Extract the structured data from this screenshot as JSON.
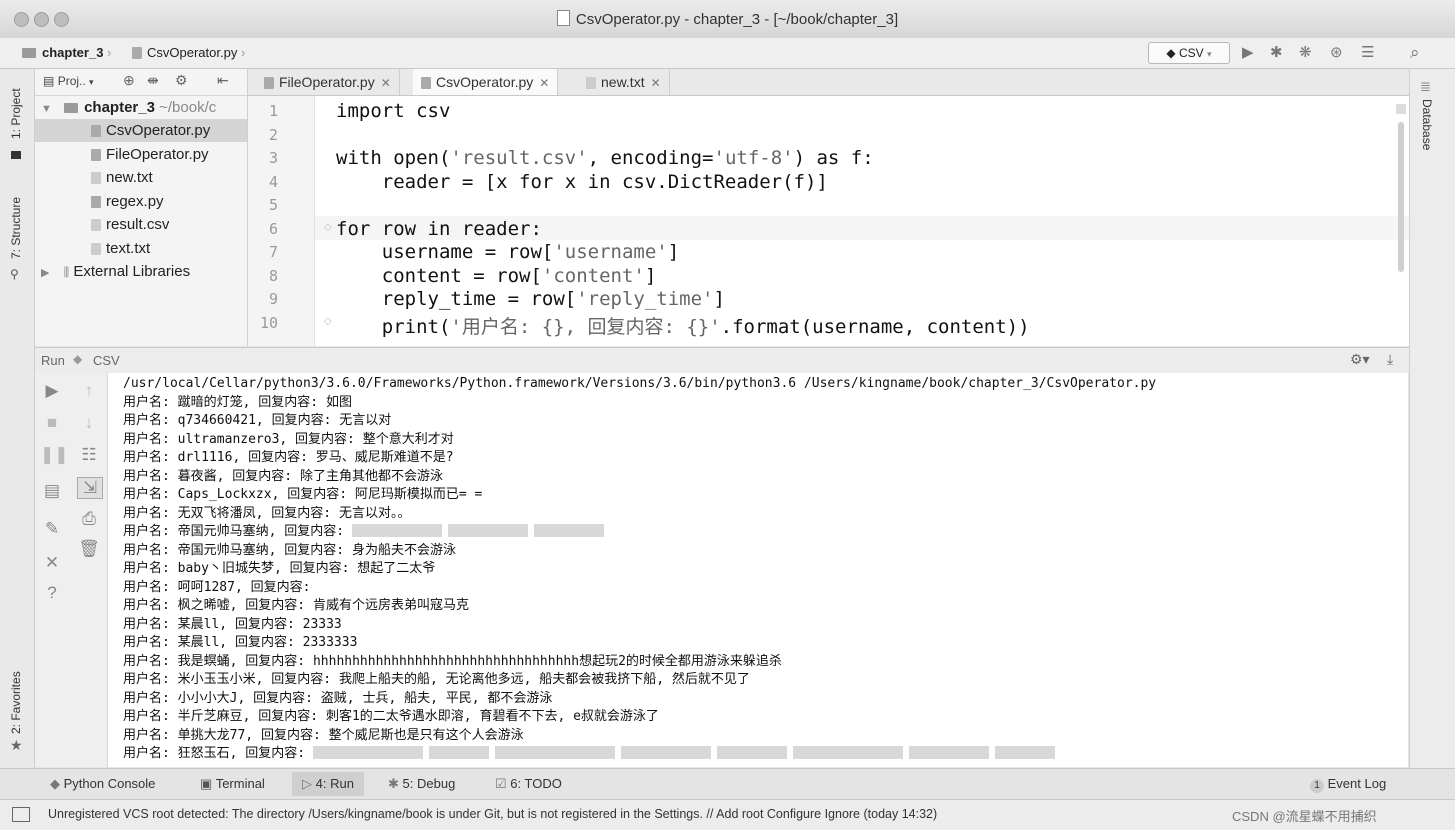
{
  "window": {
    "title": "CsvOperator.py - chapter_3 - [~/book/chapter_3]"
  },
  "navbar": {
    "breadcrumb": [
      "chapter_3",
      "CsvOperator.py"
    ],
    "run_config": "CSV"
  },
  "left_strip": {
    "project_label": "1: Project",
    "structure_label": "7: Structure",
    "favorites_label": "2: Favorites"
  },
  "right_strip": {
    "database_label": "Database"
  },
  "project_panel": {
    "toolbar_label": "Proj..",
    "tree": [
      {
        "label": "chapter_3",
        "path": "~/book/c",
        "type": "folder"
      },
      {
        "label": "CsvOperator.py",
        "type": "py"
      },
      {
        "label": "FileOperator.py",
        "type": "py"
      },
      {
        "label": "new.txt",
        "type": "txt"
      },
      {
        "label": "regex.py",
        "type": "py"
      },
      {
        "label": "result.csv",
        "type": "txt"
      },
      {
        "label": "text.txt",
        "type": "txt"
      },
      {
        "label": "External Libraries",
        "type": "lib"
      }
    ]
  },
  "tabs": [
    {
      "label": "FileOperator.py"
    },
    {
      "label": "CsvOperator.py"
    },
    {
      "label": "new.txt"
    }
  ],
  "editor": {
    "line_numbers": [
      "1",
      "2",
      "3",
      "4",
      "5",
      "6",
      "7",
      "8",
      "9",
      "10"
    ],
    "lines": [
      [
        {
          "t": "import csv"
        }
      ],
      [],
      [
        {
          "t": "with open("
        },
        {
          "s": "'result.csv'"
        },
        {
          "t": ", encoding="
        },
        {
          "s": "'utf-8'"
        },
        {
          "t": ") as f:"
        }
      ],
      [
        {
          "t": "    reader = [x for x in csv.DictReader(f)]"
        }
      ],
      [],
      [
        {
          "t": "for row in reader:"
        }
      ],
      [
        {
          "t": "    username = row["
        },
        {
          "s": "'username'"
        },
        {
          "t": "]"
        }
      ],
      [
        {
          "t": "    content = row["
        },
        {
          "s": "'content'"
        },
        {
          "t": "]"
        }
      ],
      [
        {
          "t": "    reply_time = row["
        },
        {
          "s": "'reply_time'"
        },
        {
          "t": "]"
        }
      ],
      [
        {
          "t": "    print("
        },
        {
          "s": "'用户名: {}, 回复内容: {}'"
        },
        {
          "t": ".format(username, content))"
        }
      ]
    ]
  },
  "run_panel": {
    "header_run": "Run",
    "header_config": "CSV",
    "console": [
      {
        "text": "/usr/local/Cellar/python3/3.6.0/Frameworks/Python.framework/Versions/3.6/bin/python3.6 /Users/kingname/book/chapter_3/CsvOperator.py"
      },
      {
        "text": "用户名: 蹴暗的灯笼, 回复内容: 如图"
      },
      {
        "text": "用户名: q734660421, 回复内容: 无言以对"
      },
      {
        "text": "用户名: ultramanzero3, 回复内容: 整个意大利才对"
      },
      {
        "text": "用户名: drl1116, 回复内容: 罗马、威尼斯难道不是?"
      },
      {
        "text": "用户名: 暮夜酱, 回复内容: 除了主角其他都不会游泳"
      },
      {
        "text": "用户名: Caps_Lockxzx, 回复内容: 阿尼玛斯模拟而已= ="
      },
      {
        "text": "用户名: 无双飞将潘凤, 回复内容: 无言以对。。"
      },
      {
        "text": "用户名: 帝国元帅马塞纳, 回复内容: ",
        "blur": [
          90,
          80,
          70
        ]
      },
      {
        "text": "用户名: 帝国元帅马塞纳, 回复内容: 身为船夫不会游泳"
      },
      {
        "text": "用户名: baby丶旧城失梦, 回复内容: 想起了二太爷"
      },
      {
        "text": "用户名: 呵呵1287, 回复内容: "
      },
      {
        "text": "用户名: 枫之晞嘘, 回复内容: 肯威有个远房表弟叫寇马克"
      },
      {
        "text": "用户名: 某晨ll, 回复内容: 23333"
      },
      {
        "text": "用户名: 某晨ll, 回复内容: 2333333"
      },
      {
        "text": "用户名: 我是螟蛹, 回复内容: hhhhhhhhhhhhhhhhhhhhhhhhhhhhhhhhhh想起玩2的时候全都用游泳来躲追杀"
      },
      {
        "text": "用户名: 米小玉玉小米, 回复内容: 我爬上船夫的船, 无论离他多远, 船夫都会被我挤下船, 然后就不见了"
      },
      {
        "text": "用户名: 小小小大J, 回复内容: 盗贼, 士兵, 船夫, 平民, 都不会游泳"
      },
      {
        "text": "用户名: 半斤芝麻豆, 回复内容: 刺客1的二太爷遇水即溶, 育碧看不下去, e叔就会游泳了"
      },
      {
        "text": "用户名: 单挑大龙77, 回复内容: 整个威尼斯也是只有这个人会游泳"
      },
      {
        "text": "用户名: 狂怒玉石, 回复内容: ",
        "blur": [
          110,
          60,
          120,
          90,
          70,
          110,
          80,
          60
        ]
      }
    ]
  },
  "bottom_bar": {
    "python_console": "Python Console",
    "terminal": "Terminal",
    "run": "4: Run",
    "debug": "5: Debug",
    "todo": "6: TODO",
    "event_log": "Event Log",
    "event_count": "1"
  },
  "status_bar": {
    "message": "Unregistered VCS root detected: The directory /Users/kingname/book is under Git, but is not registered in the Settings. // Add root  Configure  Ignore (today 14:32)",
    "watermark": "CSDN @流星蝶不用捕织"
  }
}
